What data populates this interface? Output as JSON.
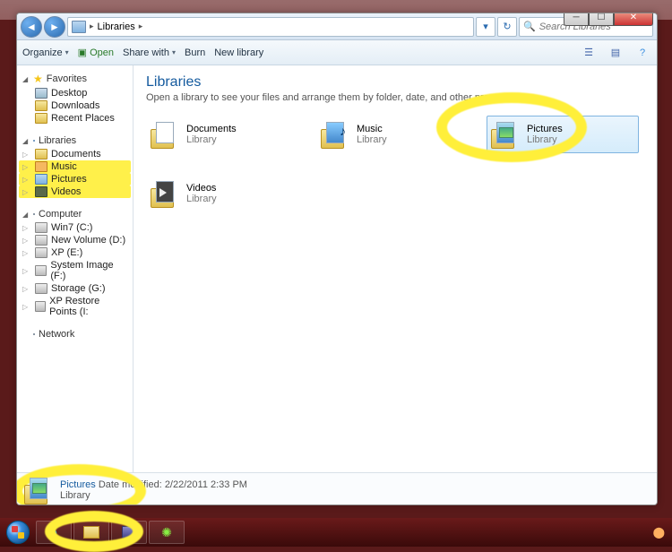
{
  "window_controls": {
    "minimize": "─",
    "maximize": "☐",
    "close": "✕"
  },
  "addressbar": {
    "back": "◄",
    "forward": "►",
    "path_root": "Libraries",
    "path_sep": "▸",
    "refresh": "↻",
    "search_placeholder": "Search Libraries",
    "search_icon": "🔍"
  },
  "toolbar": {
    "organize": "Organize",
    "open": "Open",
    "open_icon": "▣",
    "share": "Share with",
    "burn": "Burn",
    "newlib": "New library",
    "view_icon": "☰",
    "preview_icon": "▤",
    "help_icon": "?"
  },
  "nav": {
    "favorites": {
      "label": "Favorites",
      "items": [
        "Desktop",
        "Downloads",
        "Recent Places"
      ]
    },
    "libraries": {
      "label": "Libraries",
      "items": [
        "Documents",
        "Music",
        "Pictures",
        "Videos"
      ]
    },
    "computer": {
      "label": "Computer",
      "items": [
        "Win7 (C:)",
        "New Volume (D:)",
        "XP (E:)",
        "System Image (F:)",
        "Storage (G:)",
        "XP Restore Points (I:"
      ]
    },
    "network": {
      "label": "Network"
    }
  },
  "content": {
    "title": "Libraries",
    "subtitle": "Open a library to see your files and arrange them by folder, date, and other properties.",
    "type_label": "Library",
    "items": [
      {
        "name": "Documents",
        "kind": "doc"
      },
      {
        "name": "Music",
        "kind": "music"
      },
      {
        "name": "Pictures",
        "kind": "pic",
        "selected": true
      },
      {
        "name": "Videos",
        "kind": "vid"
      }
    ]
  },
  "details": {
    "name": "Pictures",
    "modified_label": "Date modified:",
    "modified_value": "2/22/2011 2:33 PM",
    "type": "Library"
  },
  "annotations": {
    "highlight_color": "#ffef3a",
    "note": "Hand-drawn yellow highlighter marks around Pictures library tile, Pictures/Music/Videos in nav tree, details pane item, and taskbar icons."
  }
}
